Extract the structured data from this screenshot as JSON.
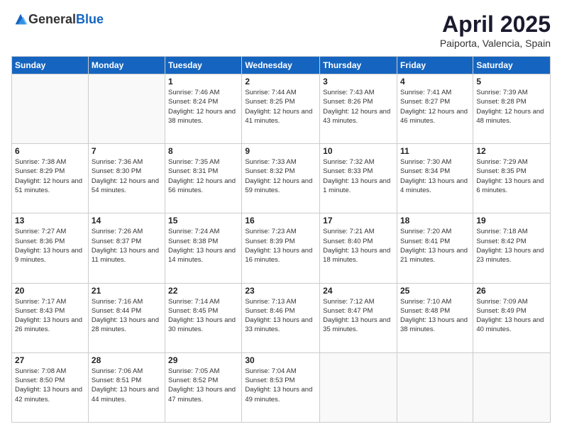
{
  "header": {
    "logo_general": "General",
    "logo_blue": "Blue",
    "title": "April 2025",
    "location": "Paiporta, Valencia, Spain"
  },
  "weekdays": [
    "Sunday",
    "Monday",
    "Tuesday",
    "Wednesday",
    "Thursday",
    "Friday",
    "Saturday"
  ],
  "weeks": [
    [
      {
        "day": "",
        "sunrise": "",
        "sunset": "",
        "daylight": ""
      },
      {
        "day": "",
        "sunrise": "",
        "sunset": "",
        "daylight": ""
      },
      {
        "day": "1",
        "sunrise": "Sunrise: 7:46 AM",
        "sunset": "Sunset: 8:24 PM",
        "daylight": "Daylight: 12 hours and 38 minutes."
      },
      {
        "day": "2",
        "sunrise": "Sunrise: 7:44 AM",
        "sunset": "Sunset: 8:25 PM",
        "daylight": "Daylight: 12 hours and 41 minutes."
      },
      {
        "day": "3",
        "sunrise": "Sunrise: 7:43 AM",
        "sunset": "Sunset: 8:26 PM",
        "daylight": "Daylight: 12 hours and 43 minutes."
      },
      {
        "day": "4",
        "sunrise": "Sunrise: 7:41 AM",
        "sunset": "Sunset: 8:27 PM",
        "daylight": "Daylight: 12 hours and 46 minutes."
      },
      {
        "day": "5",
        "sunrise": "Sunrise: 7:39 AM",
        "sunset": "Sunset: 8:28 PM",
        "daylight": "Daylight: 12 hours and 48 minutes."
      }
    ],
    [
      {
        "day": "6",
        "sunrise": "Sunrise: 7:38 AM",
        "sunset": "Sunset: 8:29 PM",
        "daylight": "Daylight: 12 hours and 51 minutes."
      },
      {
        "day": "7",
        "sunrise": "Sunrise: 7:36 AM",
        "sunset": "Sunset: 8:30 PM",
        "daylight": "Daylight: 12 hours and 54 minutes."
      },
      {
        "day": "8",
        "sunrise": "Sunrise: 7:35 AM",
        "sunset": "Sunset: 8:31 PM",
        "daylight": "Daylight: 12 hours and 56 minutes."
      },
      {
        "day": "9",
        "sunrise": "Sunrise: 7:33 AM",
        "sunset": "Sunset: 8:32 PM",
        "daylight": "Daylight: 12 hours and 59 minutes."
      },
      {
        "day": "10",
        "sunrise": "Sunrise: 7:32 AM",
        "sunset": "Sunset: 8:33 PM",
        "daylight": "Daylight: 13 hours and 1 minute."
      },
      {
        "day": "11",
        "sunrise": "Sunrise: 7:30 AM",
        "sunset": "Sunset: 8:34 PM",
        "daylight": "Daylight: 13 hours and 4 minutes."
      },
      {
        "day": "12",
        "sunrise": "Sunrise: 7:29 AM",
        "sunset": "Sunset: 8:35 PM",
        "daylight": "Daylight: 13 hours and 6 minutes."
      }
    ],
    [
      {
        "day": "13",
        "sunrise": "Sunrise: 7:27 AM",
        "sunset": "Sunset: 8:36 PM",
        "daylight": "Daylight: 13 hours and 9 minutes."
      },
      {
        "day": "14",
        "sunrise": "Sunrise: 7:26 AM",
        "sunset": "Sunset: 8:37 PM",
        "daylight": "Daylight: 13 hours and 11 minutes."
      },
      {
        "day": "15",
        "sunrise": "Sunrise: 7:24 AM",
        "sunset": "Sunset: 8:38 PM",
        "daylight": "Daylight: 13 hours and 14 minutes."
      },
      {
        "day": "16",
        "sunrise": "Sunrise: 7:23 AM",
        "sunset": "Sunset: 8:39 PM",
        "daylight": "Daylight: 13 hours and 16 minutes."
      },
      {
        "day": "17",
        "sunrise": "Sunrise: 7:21 AM",
        "sunset": "Sunset: 8:40 PM",
        "daylight": "Daylight: 13 hours and 18 minutes."
      },
      {
        "day": "18",
        "sunrise": "Sunrise: 7:20 AM",
        "sunset": "Sunset: 8:41 PM",
        "daylight": "Daylight: 13 hours and 21 minutes."
      },
      {
        "day": "19",
        "sunrise": "Sunrise: 7:18 AM",
        "sunset": "Sunset: 8:42 PM",
        "daylight": "Daylight: 13 hours and 23 minutes."
      }
    ],
    [
      {
        "day": "20",
        "sunrise": "Sunrise: 7:17 AM",
        "sunset": "Sunset: 8:43 PM",
        "daylight": "Daylight: 13 hours and 26 minutes."
      },
      {
        "day": "21",
        "sunrise": "Sunrise: 7:16 AM",
        "sunset": "Sunset: 8:44 PM",
        "daylight": "Daylight: 13 hours and 28 minutes."
      },
      {
        "day": "22",
        "sunrise": "Sunrise: 7:14 AM",
        "sunset": "Sunset: 8:45 PM",
        "daylight": "Daylight: 13 hours and 30 minutes."
      },
      {
        "day": "23",
        "sunrise": "Sunrise: 7:13 AM",
        "sunset": "Sunset: 8:46 PM",
        "daylight": "Daylight: 13 hours and 33 minutes."
      },
      {
        "day": "24",
        "sunrise": "Sunrise: 7:12 AM",
        "sunset": "Sunset: 8:47 PM",
        "daylight": "Daylight: 13 hours and 35 minutes."
      },
      {
        "day": "25",
        "sunrise": "Sunrise: 7:10 AM",
        "sunset": "Sunset: 8:48 PM",
        "daylight": "Daylight: 13 hours and 38 minutes."
      },
      {
        "day": "26",
        "sunrise": "Sunrise: 7:09 AM",
        "sunset": "Sunset: 8:49 PM",
        "daylight": "Daylight: 13 hours and 40 minutes."
      }
    ],
    [
      {
        "day": "27",
        "sunrise": "Sunrise: 7:08 AM",
        "sunset": "Sunset: 8:50 PM",
        "daylight": "Daylight: 13 hours and 42 minutes."
      },
      {
        "day": "28",
        "sunrise": "Sunrise: 7:06 AM",
        "sunset": "Sunset: 8:51 PM",
        "daylight": "Daylight: 13 hours and 44 minutes."
      },
      {
        "day": "29",
        "sunrise": "Sunrise: 7:05 AM",
        "sunset": "Sunset: 8:52 PM",
        "daylight": "Daylight: 13 hours and 47 minutes."
      },
      {
        "day": "30",
        "sunrise": "Sunrise: 7:04 AM",
        "sunset": "Sunset: 8:53 PM",
        "daylight": "Daylight: 13 hours and 49 minutes."
      },
      {
        "day": "",
        "sunrise": "",
        "sunset": "",
        "daylight": ""
      },
      {
        "day": "",
        "sunrise": "",
        "sunset": "",
        "daylight": ""
      },
      {
        "day": "",
        "sunrise": "",
        "sunset": "",
        "daylight": ""
      }
    ]
  ]
}
